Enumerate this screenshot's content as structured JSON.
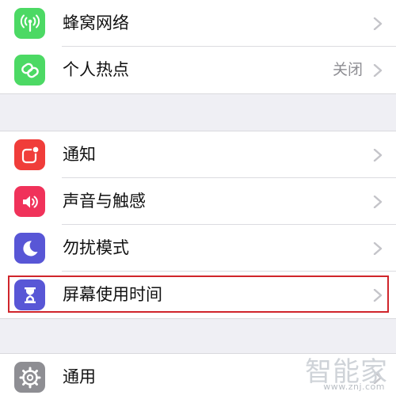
{
  "groups": [
    {
      "items": [
        {
          "label": "蜂窝网络",
          "value": "",
          "icon": "antenna-icon",
          "icon_color": "#4cd964"
        },
        {
          "label": "个人热点",
          "value": "关闭",
          "icon": "hotspot-chain-icon",
          "icon_color": "#4cd964"
        }
      ]
    },
    {
      "items": [
        {
          "label": "通知",
          "value": "",
          "icon": "notification-icon",
          "icon_color": "#f03d3a"
        },
        {
          "label": "声音与触感",
          "value": "",
          "icon": "speaker-icon",
          "icon_color": "#f0325a"
        },
        {
          "label": "勿扰模式",
          "value": "",
          "icon": "moon-icon",
          "icon_color": "#5856d6"
        },
        {
          "label": "屏幕使用时间",
          "value": "",
          "icon": "hourglass-icon",
          "icon_color": "#5856d6"
        }
      ]
    },
    {
      "items": [
        {
          "label": "通用",
          "value": "",
          "icon": "gear-icon",
          "icon_color": "#8e8e93"
        }
      ]
    }
  ],
  "highlight_color": "#d0252b",
  "watermark": {
    "text": "智能家",
    "url": "www.znj.com"
  }
}
